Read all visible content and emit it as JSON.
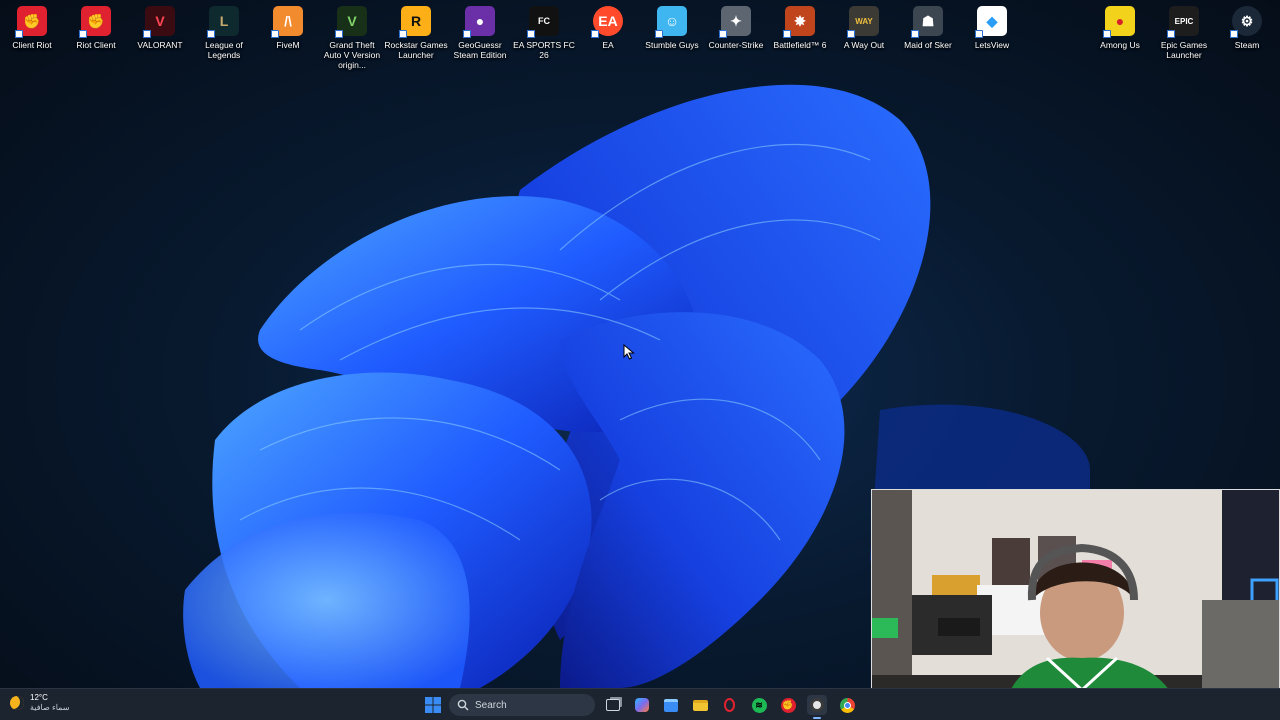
{
  "desktop": {
    "icons": [
      {
        "label": "Client Riot",
        "icon": "riot-fist-icon",
        "color": "#e0212f"
      },
      {
        "label": "Riot Client",
        "icon": "riot-fist-icon",
        "color": "#e0212f"
      },
      {
        "label": "VALORANT",
        "icon": "valorant-icon",
        "color": "#ff4655"
      },
      {
        "label": "League of Legends",
        "icon": "league-of-legends-icon",
        "color": "#c8aa6e"
      },
      {
        "label": "FiveM",
        "icon": "fivem-icon",
        "color": "#f28a2e"
      },
      {
        "label": "Grand Theft Auto V Version origin...",
        "icon": "gta-v-icon",
        "color": "#4a8f3a"
      },
      {
        "label": "Rockstar Games Launcher",
        "icon": "rockstar-icon",
        "color": "#fcaf17"
      },
      {
        "label": "GeoGuessr Steam Edition",
        "icon": "geoguessr-icon",
        "color": "#6b2fa8"
      },
      {
        "label": "EA SPORTS FC 26",
        "icon": "fc26-icon",
        "color": "#111111"
      },
      {
        "label": "EA",
        "icon": "ea-icon",
        "color": "#ff4b2b"
      },
      {
        "label": "Stumble Guys",
        "icon": "stumble-guys-icon",
        "color": "#3fb6f0"
      },
      {
        "label": "Counter-Strike",
        "icon": "counter-strike-icon",
        "color": "#5d6670"
      },
      {
        "label": "Battlefield™ 6",
        "icon": "battlefield-icon",
        "color": "#c0441c"
      },
      {
        "label": "A Way Out",
        "icon": "a-way-out-icon",
        "color": "#3c3a34"
      },
      {
        "label": "Maid of Sker",
        "icon": "maid-of-sker-icon",
        "color": "#3b4650"
      },
      {
        "label": "LetsView",
        "icon": "letsview-icon",
        "color": "#ffffff"
      },
      {
        "label": "Among Us",
        "icon": "among-us-icon",
        "color": "#d7202a"
      },
      {
        "label": "Epic Games Launcher",
        "icon": "epic-games-icon",
        "color": "#1d1d1d"
      },
      {
        "label": "Steam",
        "icon": "steam-icon",
        "color": "#1b2838"
      }
    ],
    "wallpaper_color": "#1f5bff"
  },
  "taskbar": {
    "weather": {
      "temp": "12°C",
      "condition": "سماء صافية",
      "icon": "moon-icon"
    },
    "search_label": "Search",
    "apps": [
      {
        "name": "start-button",
        "icon": "windows-logo-icon",
        "color": "#3a8cf5"
      },
      {
        "name": "task-view-button",
        "icon": "task-view-icon",
        "color": "#d0d6de"
      },
      {
        "name": "copilot-button",
        "icon": "copilot-icon",
        "color": "#7a6bf0"
      },
      {
        "name": "store-button",
        "icon": "store-icon",
        "color": "#3a8cf5"
      },
      {
        "name": "file-explorer-button",
        "icon": "folder-icon",
        "color": "#f3c431"
      },
      {
        "name": "opera-button",
        "icon": "opera-icon",
        "color": "#e0212f"
      },
      {
        "name": "spotify-button",
        "icon": "spotify-icon",
        "color": "#1db954"
      },
      {
        "name": "riot-taskbar-button",
        "icon": "riot-icon",
        "color": "#e0212f"
      },
      {
        "name": "obs-button",
        "icon": "obs-icon",
        "color": "#e6e6e6"
      },
      {
        "name": "chrome-button",
        "icon": "chrome-icon",
        "color": "#ea4335"
      }
    ]
  }
}
